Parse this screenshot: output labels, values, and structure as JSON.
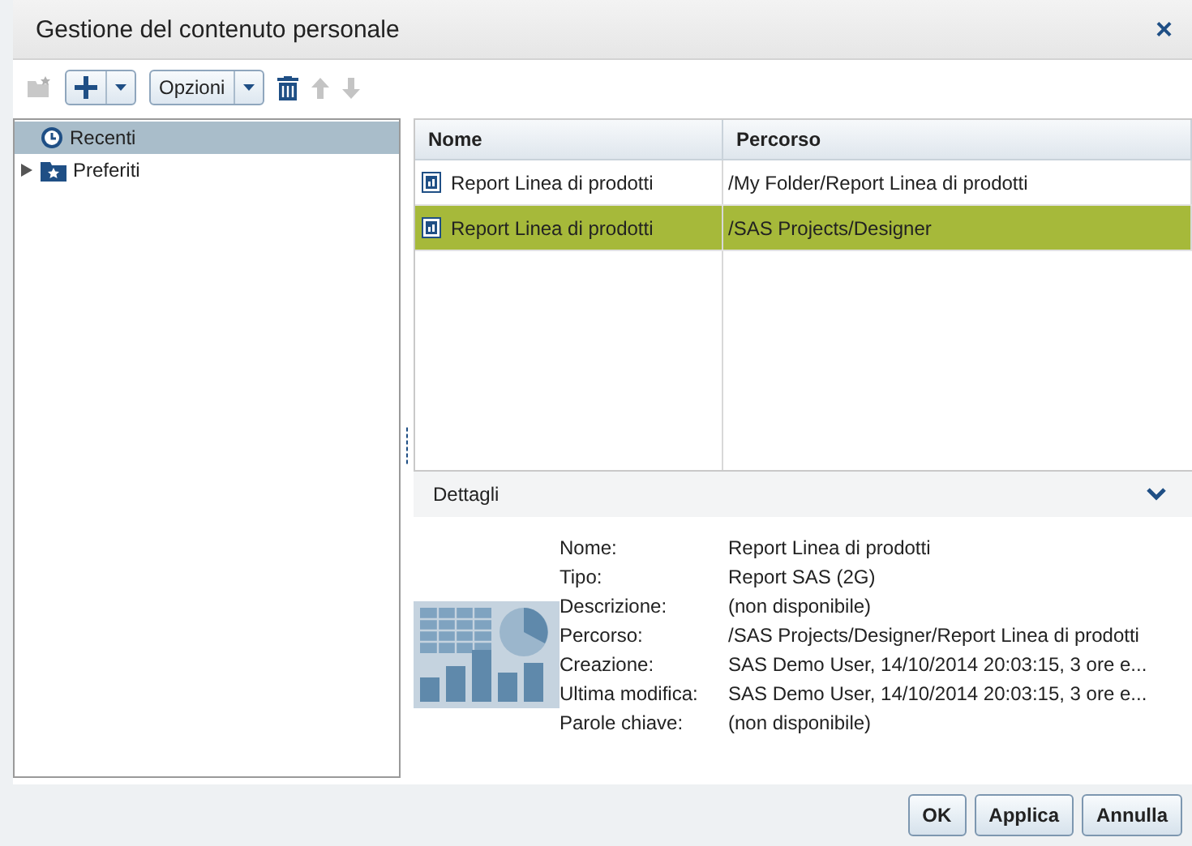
{
  "window": {
    "title": "Gestione del contenuto personale",
    "close": "×"
  },
  "toolbar": {
    "options_label": "Opzioni",
    "move_up_disabled": true,
    "move_down_disabled": true,
    "new_folder_disabled": true
  },
  "tree": [
    {
      "label": "Recenti",
      "kind": "recent",
      "selected": true
    },
    {
      "label": "Preferiti",
      "kind": "folder",
      "selected": false,
      "expanded": false
    }
  ],
  "table": {
    "columns": [
      "Nome",
      "Percorso"
    ],
    "rows": [
      {
        "cells": [
          "Report Linea di prodotti",
          "/My Folder/Report Linea di prodotti"
        ],
        "selected": false
      },
      {
        "cells": [
          "Report Linea di prodotti",
          "/SAS Projects/Designer"
        ],
        "selected": true
      }
    ]
  },
  "details": {
    "title": "Dettagli",
    "expanded": true,
    "fields": [
      {
        "label": "Nome:",
        "value": "Report Linea di prodotti"
      },
      {
        "label": "Tipo:",
        "value": "Report SAS (2G)"
      },
      {
        "label": "Descrizione:",
        "value": "(non disponibile)"
      },
      {
        "label": "Percorso:",
        "value": "/SAS Projects/Designer/Report Linea di prodotti"
      },
      {
        "label": "Creazione:",
        "value": "SAS Demo User, 14/10/2014 20:03:15, 3 ore e..."
      },
      {
        "label": "Ultima modifica:",
        "value": "SAS Demo User, 14/10/2014 20:03:15, 3 ore e..."
      },
      {
        "label": "Parole chiave:",
        "value": "(non disponibile)"
      }
    ]
  },
  "buttons": [
    "OK",
    "Applica",
    "Annulla"
  ]
}
